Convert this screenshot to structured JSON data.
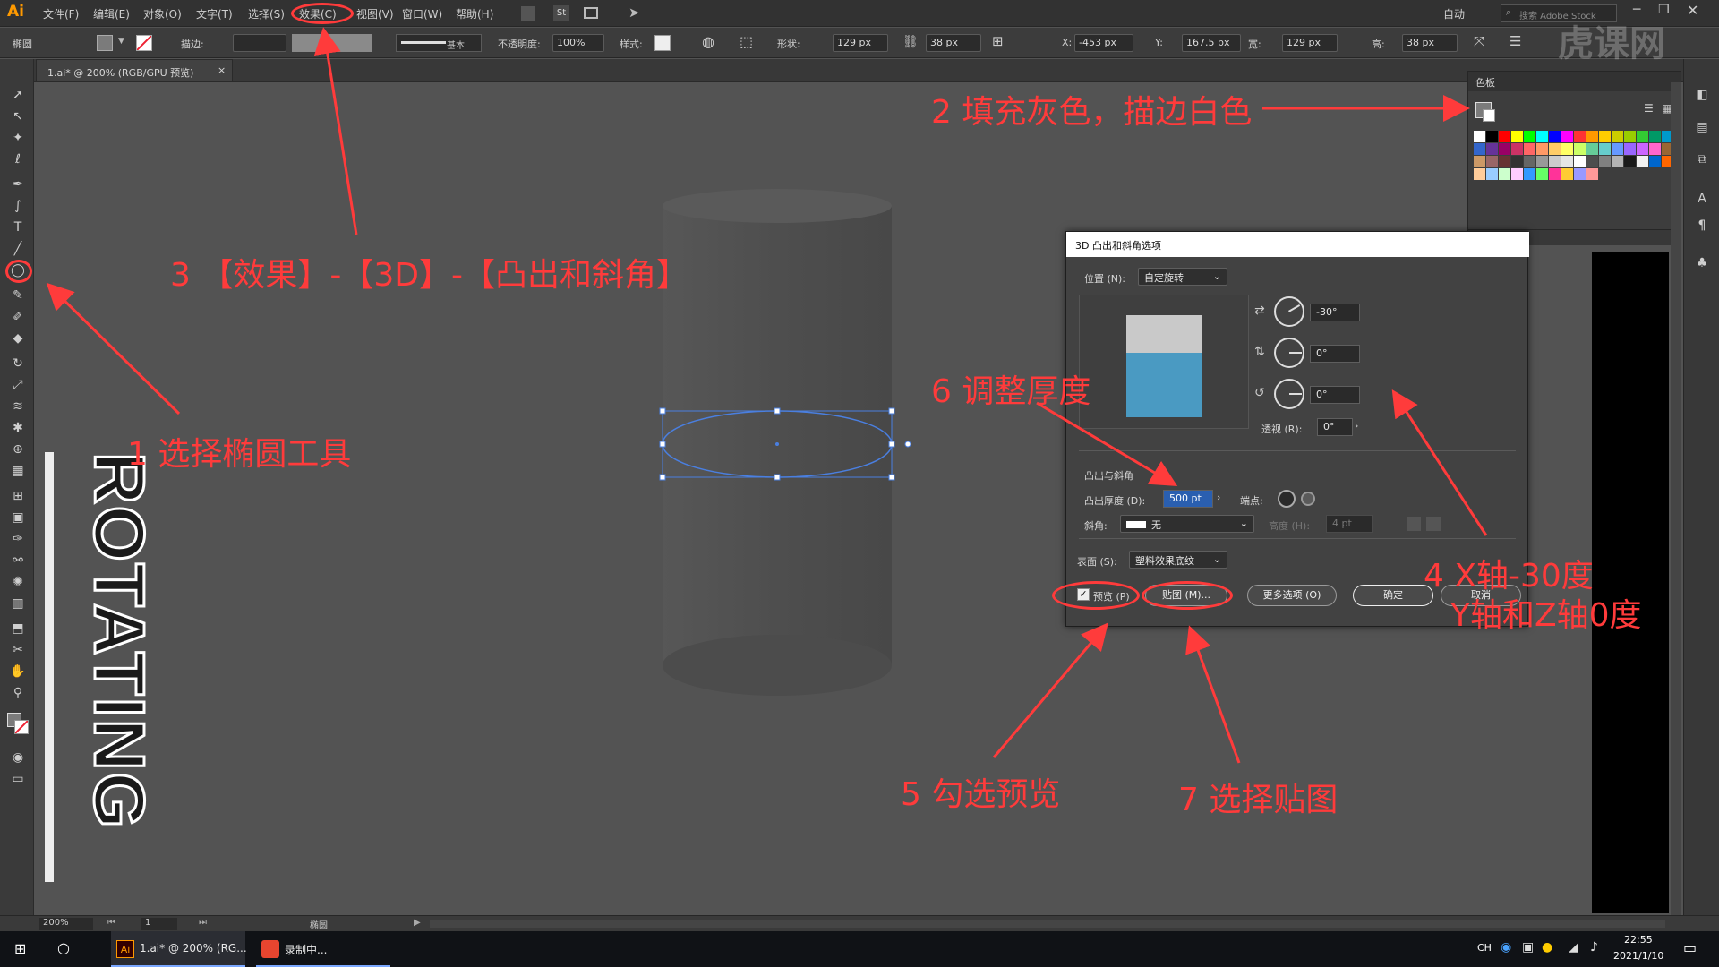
{
  "app": {
    "logo": "Ai"
  },
  "menubar": {
    "items": [
      "文件(F)",
      "编辑(E)",
      "对象(O)",
      "文字(T)",
      "选择(S)",
      "效果(C)",
      "视图(V)",
      "窗口(W)",
      "帮助(H)"
    ],
    "workspace": "自动",
    "search_placeholder": "搜索 Adobe Stock",
    "stock_logo": "St"
  },
  "controlbar": {
    "object_type": "椭圆",
    "stroke_label": "描边:",
    "stroke_style": "基本",
    "opacity_label": "不透明度:",
    "opacity_value": "100%",
    "style_label": "样式:",
    "shape_label": "形状:",
    "shape_w": "129 px",
    "shape_h": "38 px",
    "x_label": "X:",
    "x_value": "-453 px",
    "y_label": "Y:",
    "y_value": "167.5 px",
    "w_label": "宽:",
    "w_value": "129 px",
    "h_label": "高:",
    "h_value": "38 px"
  },
  "document_tab": {
    "title": "1.ai* @ 200% (RGB/GPU 预览)",
    "close": "×"
  },
  "swatches_panel": {
    "title": "色板"
  },
  "canvas": {
    "vertical_text": "ROTATING"
  },
  "dialog": {
    "title": "3D 凸出和斜角选项",
    "position_label": "位置 (N):",
    "position_value": "自定旋转",
    "rot_x": "-30°",
    "rot_y": "0°",
    "rot_z": "0°",
    "perspective_label": "透视 (R):",
    "perspective_value": "0°",
    "extrude_section": "凸出与斜角",
    "depth_label": "凸出厚度 (D):",
    "depth_value": "500 pt",
    "cap_label": "端点:",
    "bevel_label": "斜角:",
    "bevel_value": "无",
    "height_label": "高度 (H):",
    "height_value": "4 pt",
    "surface_label": "表面 (S):",
    "surface_value": "塑料效果底纹",
    "preview_label": "预览 (P)",
    "map_label": "贴图 (M)...",
    "more_label": "更多选项 (O)",
    "ok_label": "确定",
    "cancel_label": "取消"
  },
  "annotations": {
    "a1": "1 选择椭圆工具",
    "a2": "2 填充灰色，描边白色",
    "a3": "3 【效果】-【3D】-【凸出和斜角】",
    "a4_line1": "4 X轴-30度",
    "a4_line2": "Y轴和Z轴0度",
    "a5": "5 勾选预览",
    "a6": "6 调整厚度",
    "a7": "7 选择贴图",
    "color": "#ff3b3b"
  },
  "statusbar": {
    "zoom": "200%",
    "page": "1",
    "tool": "椭圆"
  },
  "taskbar": {
    "app1": "1.ai* @ 200% (RG...",
    "app2": "录制中...",
    "time": "22:55",
    "date": "2021/1/10",
    "ime": "CH"
  },
  "watermark": "虎课网",
  "colors": {
    "bg": "#535353",
    "cylinder": "#4a4a4a",
    "selection": "#4a7fe0",
    "preview_top": "#c9c9c9",
    "preview_front": "#4a9ac2"
  }
}
